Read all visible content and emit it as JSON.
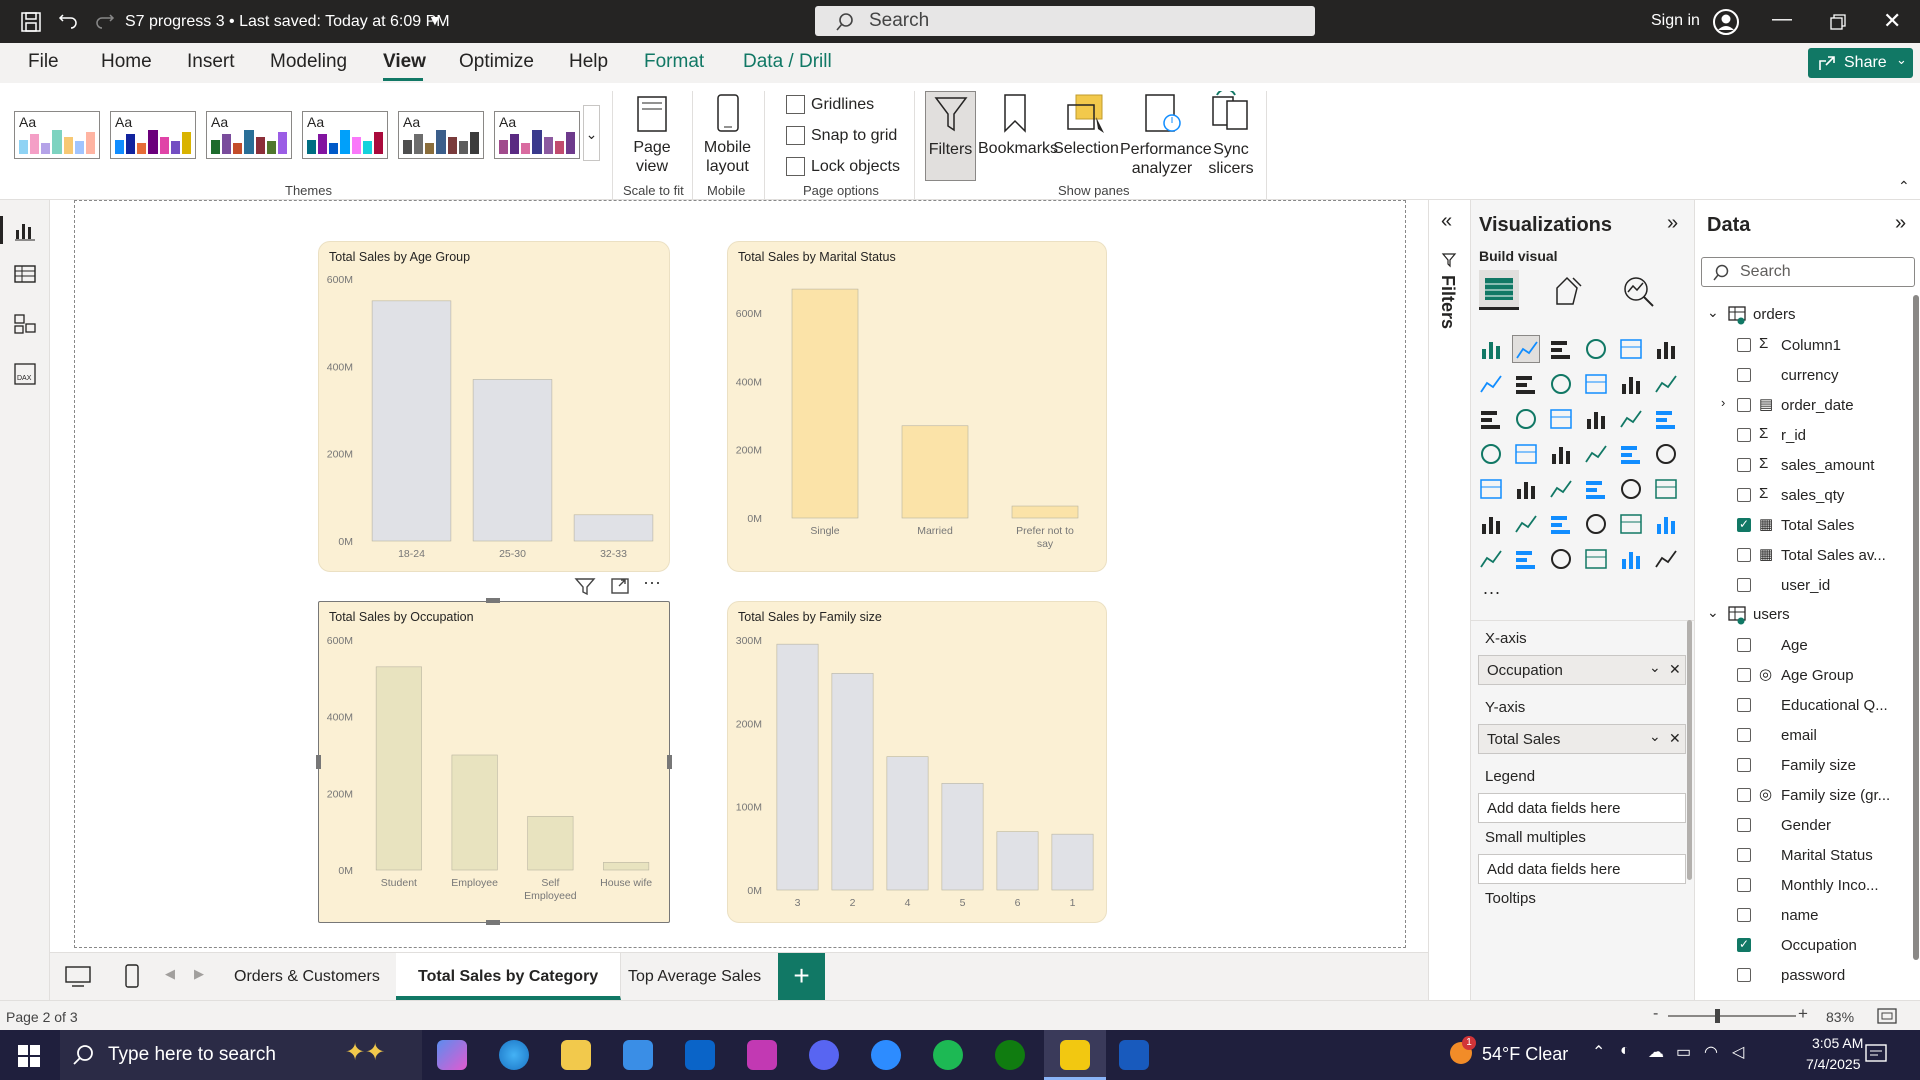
{
  "titlebar": {
    "file_title": "S7 progress 3 • Last saved: Today at 6:09 PM",
    "search": "Search",
    "sign_in": "Sign in"
  },
  "ribbon_tabs": [
    "File",
    "Home",
    "Insert",
    "Modeling",
    "View",
    "Optimize",
    "Help",
    "Format",
    "Data / Drill"
  ],
  "share_label": "Share",
  "ribbon": {
    "themes_label": "Themes",
    "theme_aa": "Aa",
    "page_view": "Page\nview",
    "scale_to_fit": "Scale to fit",
    "mobile_layout": "Mobile\nlayout",
    "mobile": "Mobile",
    "gridlines": "Gridlines",
    "snap_to_grid": "Snap to grid",
    "lock_objects": "Lock objects",
    "page_options": "Page options",
    "filters": "Filters",
    "bookmarks": "Bookmarks",
    "selection": "Selection",
    "performance_analyzer": "Performance\nanalyzer",
    "sync_slicers": "Sync\nslicers",
    "show_panes": "Show panes"
  },
  "theme_colors": [
    [
      "#8fd3f4",
      "#f49fc6",
      "#b5a3e8",
      "#7dd3c0",
      "#f7c873",
      "#a0c4ff",
      "#ffb4a2"
    ],
    [
      "#118dff",
      "#12239e",
      "#e66c37",
      "#6b007b",
      "#e044a7",
      "#744ec2",
      "#d9b300"
    ],
    [
      "#1d6b2c",
      "#7a4c9c",
      "#c44d2a",
      "#2a6f97",
      "#8c2f39",
      "#4f772d",
      "#9b5de5"
    ],
    [
      "#006e82",
      "#8214a0",
      "#005ac8",
      "#00a0fa",
      "#fa78fa",
      "#14d2dc",
      "#aa0a3c"
    ],
    [
      "#4e4e4e",
      "#6d6d6d",
      "#8a6d3b",
      "#3b5e8a",
      "#7a3b3b",
      "#5e5e5e",
      "#3b3b3b"
    ],
    [
      "#a14b8c",
      "#5a2a82",
      "#d96ba0",
      "#3a3a8c",
      "#8c5aa0",
      "#c14b6e",
      "#6e3a8c"
    ]
  ],
  "charts": [
    {
      "type": "bar",
      "title": "Total Sales by Age Group",
      "categories": [
        "18-24",
        "25-30",
        "32-33"
      ],
      "values": [
        550,
        370,
        60
      ],
      "yticks": [
        "600M",
        "400M",
        "200M",
        "0M"
      ],
      "ylim": [
        0,
        600
      ],
      "color": "#e0e1e6"
    },
    {
      "type": "bar",
      "title": "Total Sales by Marital Status",
      "categories": [
        "Single",
        "Married",
        "Prefer not to say"
      ],
      "values": [
        670,
        270,
        35
      ],
      "yticks": [
        "600M",
        "400M",
        "200M",
        "0M"
      ],
      "ylim": [
        0,
        600
      ],
      "color": "#fbe3a8"
    },
    {
      "type": "bar",
      "title": "Total Sales by Occupation",
      "categories": [
        "Student",
        "Employee",
        "Self Employeed",
        "House wife"
      ],
      "values": [
        530,
        300,
        140,
        20
      ],
      "yticks": [
        "600M",
        "400M",
        "200M",
        "0M"
      ],
      "ylim": [
        0,
        600
      ],
      "color": "#e8e3bf"
    },
    {
      "type": "bar",
      "title": "Total Sales by Family size",
      "categories": [
        "3",
        "2",
        "4",
        "5",
        "6",
        "1"
      ],
      "values": [
        295,
        260,
        160,
        128,
        70,
        67
      ],
      "yticks": [
        "300M",
        "200M",
        "100M",
        "0M"
      ],
      "ylim": [
        0,
        300
      ],
      "color": "#e0e1e6"
    }
  ],
  "filters_label": "Filters",
  "visualizations": {
    "title": "Visualizations",
    "build_visual": "Build visual",
    "more": "...",
    "wells": [
      {
        "label": "X-axis",
        "value": "Occupation"
      },
      {
        "label": "Y-axis",
        "value": "Total Sales"
      },
      {
        "label": "Legend",
        "value": "Add data fields here"
      },
      {
        "label": "Small multiples",
        "value": "Add data fields here"
      },
      {
        "label": "Tooltips",
        "value": ""
      }
    ]
  },
  "data_pane": {
    "title": "Data",
    "search_placeholder": "Search",
    "tables": [
      {
        "name": "orders",
        "fields": [
          {
            "name": "Column1",
            "icon": "sigma",
            "checked": false
          },
          {
            "name": "currency",
            "icon": "",
            "checked": false
          },
          {
            "name": "order_date",
            "icon": "calendar",
            "checked": false,
            "expand": true
          },
          {
            "name": "r_id",
            "icon": "sigma",
            "checked": false
          },
          {
            "name": "sales_amount",
            "icon": "sigma",
            "checked": false
          },
          {
            "name": "sales_qty",
            "icon": "sigma",
            "checked": false
          },
          {
            "name": "Total Sales",
            "icon": "calc",
            "checked": true
          },
          {
            "name": "Total Sales av...",
            "icon": "calc",
            "checked": false
          },
          {
            "name": "user_id",
            "icon": "",
            "checked": false
          }
        ]
      },
      {
        "name": "users",
        "fields": [
          {
            "name": "Age",
            "icon": "",
            "checked": false
          },
          {
            "name": "Age Group",
            "icon": "group",
            "checked": false
          },
          {
            "name": "Educational Q...",
            "icon": "",
            "checked": false
          },
          {
            "name": "email",
            "icon": "",
            "checked": false
          },
          {
            "name": "Family size",
            "icon": "",
            "checked": false
          },
          {
            "name": "Family size (gr...",
            "icon": "group",
            "checked": false
          },
          {
            "name": "Gender",
            "icon": "",
            "checked": false
          },
          {
            "name": "Marital Status",
            "icon": "",
            "checked": false
          },
          {
            "name": "Monthly Inco...",
            "icon": "",
            "checked": false
          },
          {
            "name": "name",
            "icon": "",
            "checked": false
          },
          {
            "name": "Occupation",
            "icon": "",
            "checked": true
          },
          {
            "name": "password",
            "icon": "",
            "checked": false
          }
        ]
      }
    ]
  },
  "page_tabs": [
    "Orders & Customers",
    "Total Sales by Category",
    "Top Average Sales"
  ],
  "active_page_tab": 1,
  "status": {
    "page": "Page 2 of 3",
    "zoom": "83%"
  },
  "taskbar": {
    "search": "Type here to search",
    "weather": "54°F  Clear",
    "time": "3:05 AM",
    "date": "7/4/2025",
    "notification_count": "1"
  }
}
